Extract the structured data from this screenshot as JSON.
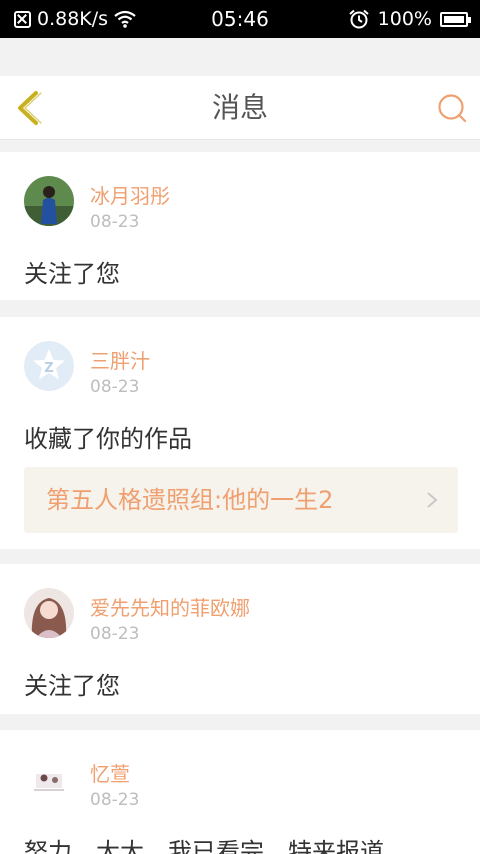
{
  "status_bar": {
    "net_speed": "0.88K/s",
    "time": "05:46",
    "battery": "100%"
  },
  "header": {
    "title": "消息"
  },
  "notifications": [
    {
      "user": "冰月羽彤",
      "date": "08-23",
      "action": "关注了您"
    },
    {
      "user": "三胖汁",
      "date": "08-23",
      "action": "收藏了你的作品",
      "work_title": "第五人格遗照组:他的一生2"
    },
    {
      "user": "爱先先知的菲欧娜",
      "date": "08-23",
      "action": "关注了您"
    },
    {
      "user": "忆萱",
      "date": "08-23",
      "action": "努力，大大，我已看完，特来报道"
    }
  ],
  "colors": {
    "accent": "#f0a070",
    "back_arrow": "#c8b020",
    "background": "#f2f2f2"
  }
}
